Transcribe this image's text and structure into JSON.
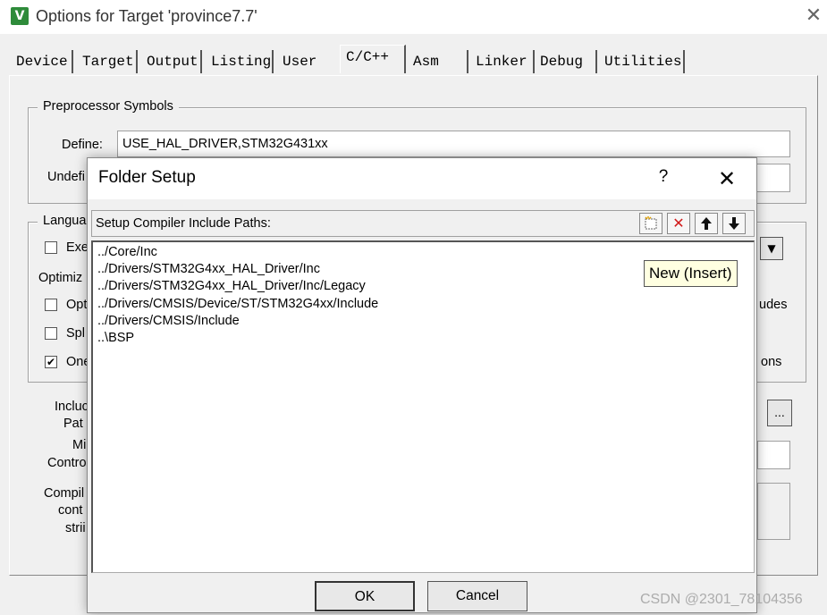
{
  "window": {
    "icon_text": "V",
    "title": "Options for Target 'province7.7'",
    "close_glyph": "✕"
  },
  "tabs": [
    {
      "label": "Device"
    },
    {
      "label": "Target"
    },
    {
      "label": "Output"
    },
    {
      "label": "Listing"
    },
    {
      "label": "User"
    },
    {
      "label": "C/C++"
    },
    {
      "label": "Asm"
    },
    {
      "label": "Linker"
    },
    {
      "label": "Debug"
    },
    {
      "label": "Utilities"
    }
  ],
  "preprocessor": {
    "legend": "Preprocessor Symbols",
    "define_label": "Define:",
    "define_value": "USE_HAL_DRIVER,STM32G431xx",
    "undefine_label": "Undefi",
    "undefine_value": ""
  },
  "language": {
    "legend": "Langua",
    "checks": [
      {
        "label": "Exe",
        "checked": false
      },
      {
        "label": "Opti",
        "checked": false
      },
      {
        "label": "Spl",
        "checked": false
      },
      {
        "label": "One",
        "checked": true
      }
    ],
    "optimize_label": "Optimiz",
    "right_text_1": "udes",
    "right_text_2": "ons",
    "combo_glyph": "▼"
  },
  "lower_labels": {
    "include_1": "Incluc",
    "include_2": "Pat",
    "misc_1": "Mi",
    "misc_2": "Contro",
    "compiler_1": "Compil",
    "compiler_2": "cont",
    "compiler_3": "strii",
    "browse_label": "..."
  },
  "dialog": {
    "title": "Folder Setup",
    "help_glyph": "?",
    "close_glyph": "✕",
    "list_header": "Setup Compiler Include Paths:",
    "toolbar": {
      "new_glyph": "🗋",
      "delete_glyph": "✕",
      "up_glyph": "🡅",
      "down_glyph": "🡇"
    },
    "paths": [
      "../Core/Inc",
      "../Drivers/STM32G4xx_HAL_Driver/Inc",
      "../Drivers/STM32G4xx_HAL_Driver/Inc/Legacy",
      "../Drivers/CMSIS/Device/ST/STM32G4xx/Include",
      "../Drivers/CMSIS/Include",
      "..\\BSP"
    ],
    "tooltip": "New (Insert)",
    "ok_label": "OK",
    "cancel_label": "Cancel"
  },
  "watermark": "CSDN @2301_78104356",
  "colors": {
    "delete_icon": "#d11a1a",
    "tooltip_bg": "#ffffe1",
    "app_icon": "#2e8b3a"
  }
}
